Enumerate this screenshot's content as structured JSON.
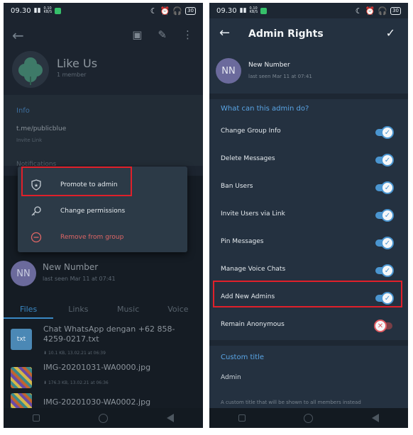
{
  "status": {
    "time": "09.30",
    "net_speed_top": "0,10",
    "net_speed_unit": "KB/S",
    "battery": "30"
  },
  "left": {
    "group": {
      "title": "Like Us",
      "subtitle": "1 member"
    },
    "info_header": "Info",
    "link": "t.me/publicblue",
    "link_label": "Invite Link",
    "notif_peek": "Notifications",
    "menu": [
      {
        "label": "Promote to admin",
        "icon": "shield-star-icon"
      },
      {
        "label": "Change permissions",
        "icon": "key-icon"
      },
      {
        "label": "Remove from group",
        "icon": "minus-circle-icon"
      }
    ],
    "member": {
      "initials": "NN",
      "name": "New Number",
      "seen": "last seen Mar 11 at 07:41"
    },
    "tabs": [
      "Files",
      "Links",
      "Music",
      "Voice"
    ],
    "files": [
      {
        "name": "Chat WhatsApp dengan +62 858-4259-0217.txt",
        "meta": "10.1 KB, 13.02.21 at 06:39",
        "thumb": "txt"
      },
      {
        "name": "IMG-20201031-WA0000.jpg",
        "meta": "176.3 KB, 13.02.21 at 06:36",
        "thumb": ""
      },
      {
        "name": "IMG-20201030-WA0002.jpg",
        "meta": "",
        "thumb": ""
      }
    ]
  },
  "right": {
    "title": "Admin Rights",
    "user": {
      "initials": "NN",
      "name": "New Number",
      "seen": "last seen Mar 11 at 07:41"
    },
    "section_header": "What can this admin do?",
    "permissions": [
      {
        "label": "Change Group Info",
        "on": true
      },
      {
        "label": "Delete Messages",
        "on": true
      },
      {
        "label": "Ban Users",
        "on": true
      },
      {
        "label": "Invite Users via Link",
        "on": true
      },
      {
        "label": "Pin Messages",
        "on": true
      },
      {
        "label": "Manage Voice Chats",
        "on": true
      },
      {
        "label": "Add New Admins",
        "on": true
      },
      {
        "label": "Remain Anonymous",
        "on": false
      }
    ],
    "custom_title_header": "Custom title",
    "custom_title_value": "Admin",
    "custom_title_hint": "A custom title that will be shown to all members instead"
  }
}
